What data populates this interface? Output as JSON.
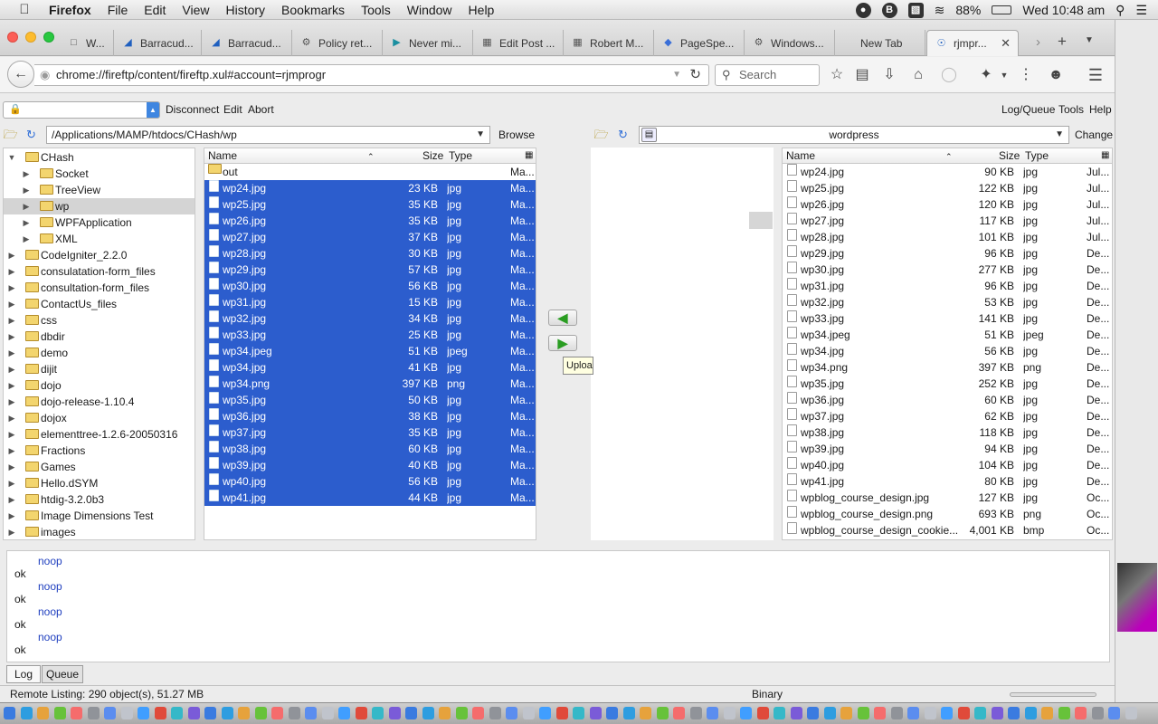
{
  "menubar": {
    "app": "Firefox",
    "items": [
      "File",
      "Edit",
      "View",
      "History",
      "Bookmarks",
      "Tools",
      "Window",
      "Help"
    ],
    "battery": "88%",
    "clock": "Wed 10:48 am"
  },
  "tabs": [
    {
      "label": "W..."
    },
    {
      "label": "Barracud..."
    },
    {
      "label": "Barracud..."
    },
    {
      "label": "Policy ret..."
    },
    {
      "label": "Never mi..."
    },
    {
      "label": "Edit Post ..."
    },
    {
      "label": "Robert M..."
    },
    {
      "label": "PageSpe..."
    },
    {
      "label": "Windows..."
    },
    {
      "label": "New Tab"
    },
    {
      "label": "rjmpr..."
    }
  ],
  "navbar": {
    "url": "chrome://fireftp/content/fireftp.xul#account=rjmprogr",
    "search_placeholder": "Search"
  },
  "ftp_toolbar": {
    "disconnect": "Disconnect",
    "edit": "Edit",
    "abort": "Abort",
    "log_queue": "Log/Queue",
    "tools": "Tools",
    "help": "Help"
  },
  "local": {
    "path": "/Applications/MAMP/htdocs/CHash/wp",
    "browse": "Browse",
    "headers": {
      "name": "Name",
      "size": "Size",
      "type": "Type"
    },
    "tree": [
      {
        "label": "CHash",
        "level": 0,
        "open": true
      },
      {
        "label": "Socket",
        "level": 1
      },
      {
        "label": "TreeView",
        "level": 1
      },
      {
        "label": "wp",
        "level": 1,
        "selected": true
      },
      {
        "label": "WPFApplication",
        "level": 1
      },
      {
        "label": "XML",
        "level": 1
      },
      {
        "label": "CodeIgniter_2.2.0",
        "level": 0
      },
      {
        "label": "consulatation-form_files",
        "level": 0
      },
      {
        "label": "consultation-form_files",
        "level": 0
      },
      {
        "label": "ContactUs_files",
        "level": 0
      },
      {
        "label": "css",
        "level": 0
      },
      {
        "label": "dbdir",
        "level": 0
      },
      {
        "label": "demo",
        "level": 0
      },
      {
        "label": "dijit",
        "level": 0
      },
      {
        "label": "dojo",
        "level": 0
      },
      {
        "label": "dojo-release-1.10.4",
        "level": 0
      },
      {
        "label": "dojox",
        "level": 0
      },
      {
        "label": "elementtree-1.2.6-20050316",
        "level": 0
      },
      {
        "label": "Fractions",
        "level": 0
      },
      {
        "label": "Games",
        "level": 0
      },
      {
        "label": "Hello.dSYM",
        "level": 0
      },
      {
        "label": "htdig-3.2.0b3",
        "level": 0
      },
      {
        "label": "Image Dimensions Test",
        "level": 0
      },
      {
        "label": "images",
        "level": 0
      }
    ],
    "files": [
      {
        "name": "out",
        "size": "",
        "type": "",
        "date": "Ma...",
        "folder": true
      },
      {
        "name": "wp24.jpg",
        "size": "23 KB",
        "type": "jpg",
        "date": "Ma...",
        "selected": true
      },
      {
        "name": "wp25.jpg",
        "size": "35 KB",
        "type": "jpg",
        "date": "Ma...",
        "selected": true
      },
      {
        "name": "wp26.jpg",
        "size": "35 KB",
        "type": "jpg",
        "date": "Ma...",
        "selected": true
      },
      {
        "name": "wp27.jpg",
        "size": "37 KB",
        "type": "jpg",
        "date": "Ma...",
        "selected": true
      },
      {
        "name": "wp28.jpg",
        "size": "30 KB",
        "type": "jpg",
        "date": "Ma...",
        "selected": true
      },
      {
        "name": "wp29.jpg",
        "size": "57 KB",
        "type": "jpg",
        "date": "Ma...",
        "selected": true
      },
      {
        "name": "wp30.jpg",
        "size": "56 KB",
        "type": "jpg",
        "date": "Ma...",
        "selected": true
      },
      {
        "name": "wp31.jpg",
        "size": "15 KB",
        "type": "jpg",
        "date": "Ma...",
        "selected": true
      },
      {
        "name": "wp32.jpg",
        "size": "34 KB",
        "type": "jpg",
        "date": "Ma...",
        "selected": true
      },
      {
        "name": "wp33.jpg",
        "size": "25 KB",
        "type": "jpg",
        "date": "Ma...",
        "selected": true
      },
      {
        "name": "wp34.jpeg",
        "size": "51 KB",
        "type": "jpeg",
        "date": "Ma...",
        "selected": true
      },
      {
        "name": "wp34.jpg",
        "size": "41 KB",
        "type": "jpg",
        "date": "Ma...",
        "selected": true
      },
      {
        "name": "wp34.png",
        "size": "397 KB",
        "type": "png",
        "date": "Ma...",
        "selected": true
      },
      {
        "name": "wp35.jpg",
        "size": "50 KB",
        "type": "jpg",
        "date": "Ma...",
        "selected": true
      },
      {
        "name": "wp36.jpg",
        "size": "38 KB",
        "type": "jpg",
        "date": "Ma...",
        "selected": true
      },
      {
        "name": "wp37.jpg",
        "size": "35 KB",
        "type": "jpg",
        "date": "Ma...",
        "selected": true
      },
      {
        "name": "wp38.jpg",
        "size": "60 KB",
        "type": "jpg",
        "date": "Ma...",
        "selected": true
      },
      {
        "name": "wp39.jpg",
        "size": "40 KB",
        "type": "jpg",
        "date": "Ma...",
        "selected": true
      },
      {
        "name": "wp40.jpg",
        "size": "56 KB",
        "type": "jpg",
        "date": "Ma...",
        "selected": true
      },
      {
        "name": "wp41.jpg",
        "size": "44 KB",
        "type": "jpg",
        "date": "Ma...",
        "selected": true
      }
    ]
  },
  "remote": {
    "path": "wordpress",
    "change": "Change",
    "headers": {
      "name": "Name",
      "size": "Size",
      "type": "Type"
    },
    "files": [
      {
        "name": "wp24.jpg",
        "size": "90 KB",
        "type": "jpg",
        "date": "Jul..."
      },
      {
        "name": "wp25.jpg",
        "size": "122 KB",
        "type": "jpg",
        "date": "Jul..."
      },
      {
        "name": "wp26.jpg",
        "size": "120 KB",
        "type": "jpg",
        "date": "Jul..."
      },
      {
        "name": "wp27.jpg",
        "size": "117 KB",
        "type": "jpg",
        "date": "Jul..."
      },
      {
        "name": "wp28.jpg",
        "size": "101 KB",
        "type": "jpg",
        "date": "Jul..."
      },
      {
        "name": "wp29.jpg",
        "size": "96 KB",
        "type": "jpg",
        "date": "De..."
      },
      {
        "name": "wp30.jpg",
        "size": "277 KB",
        "type": "jpg",
        "date": "De..."
      },
      {
        "name": "wp31.jpg",
        "size": "96 KB",
        "type": "jpg",
        "date": "De..."
      },
      {
        "name": "wp32.jpg",
        "size": "53 KB",
        "type": "jpg",
        "date": "De..."
      },
      {
        "name": "wp33.jpg",
        "size": "141 KB",
        "type": "jpg",
        "date": "De..."
      },
      {
        "name": "wp34.jpeg",
        "size": "51 KB",
        "type": "jpeg",
        "date": "De..."
      },
      {
        "name": "wp34.jpg",
        "size": "56 KB",
        "type": "jpg",
        "date": "De..."
      },
      {
        "name": "wp34.png",
        "size": "397 KB",
        "type": "png",
        "date": "De..."
      },
      {
        "name": "wp35.jpg",
        "size": "252 KB",
        "type": "jpg",
        "date": "De..."
      },
      {
        "name": "wp36.jpg",
        "size": "60 KB",
        "type": "jpg",
        "date": "De..."
      },
      {
        "name": "wp37.jpg",
        "size": "62 KB",
        "type": "jpg",
        "date": "De..."
      },
      {
        "name": "wp38.jpg",
        "size": "118 KB",
        "type": "jpg",
        "date": "De..."
      },
      {
        "name": "wp39.jpg",
        "size": "94 KB",
        "type": "jpg",
        "date": "De..."
      },
      {
        "name": "wp40.jpg",
        "size": "104 KB",
        "type": "jpg",
        "date": "De..."
      },
      {
        "name": "wp41.jpg",
        "size": "80 KB",
        "type": "jpg",
        "date": "De..."
      },
      {
        "name": "wpblog_course_design.jpg",
        "size": "127 KB",
        "type": "jpg",
        "date": "Oc..."
      },
      {
        "name": "wpblog_course_design.png",
        "size": "693 KB",
        "type": "png",
        "date": "Oc..."
      },
      {
        "name": "wpblog_course_design_cookie...",
        "size": "4,001 KB",
        "type": "bmp",
        "date": "Oc..."
      }
    ]
  },
  "tooltip": "Upload",
  "log": [
    {
      "text": "noop",
      "kind": "cmd"
    },
    {
      "text": "ok",
      "kind": "resp"
    },
    {
      "text": "noop",
      "kind": "cmd"
    },
    {
      "text": "ok",
      "kind": "resp"
    },
    {
      "text": "noop",
      "kind": "cmd"
    },
    {
      "text": "ok",
      "kind": "resp"
    },
    {
      "text": "noop",
      "kind": "cmd"
    },
    {
      "text": "ok",
      "kind": "resp"
    }
  ],
  "log_tabs": {
    "log": "Log",
    "queue": "Queue"
  },
  "status": {
    "listing": "Remote Listing: 290 object(s), 51.27 MB",
    "mode": "Binary"
  },
  "colors": {
    "selection": "#2c5dcd",
    "log_cmd": "#1f3fbf"
  }
}
